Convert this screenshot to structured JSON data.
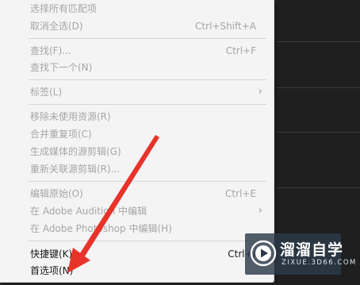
{
  "menu": {
    "items": [
      {
        "label": "选择所有匹配项",
        "shortcut": "",
        "enabled": false
      },
      {
        "label": "取消全选(D)",
        "shortcut": "Ctrl+Shift+A",
        "enabled": false
      },
      {
        "label": "查找(F)...",
        "shortcut": "Ctrl+F",
        "enabled": false
      },
      {
        "label": "查找下一个(N)",
        "shortcut": "",
        "enabled": false
      },
      {
        "label": "标签(L)",
        "shortcut": "",
        "enabled": false,
        "submenu": true
      },
      {
        "label": "移除未使用资源(R)",
        "shortcut": "",
        "enabled": false
      },
      {
        "label": "合并重复项(C)",
        "shortcut": "",
        "enabled": false
      },
      {
        "label": "生成媒体的源剪辑(G)",
        "shortcut": "",
        "enabled": false
      },
      {
        "label": "重新关联源剪辑(R)...",
        "shortcut": "",
        "enabled": false
      },
      {
        "label": "编辑原始(O)",
        "shortcut": "Ctrl+E",
        "enabled": false
      },
      {
        "label": "在 Adobe Audition 中编辑",
        "shortcut": "",
        "enabled": false,
        "submenu": true
      },
      {
        "label": "在 Adobe Photoshop 中编辑(H)",
        "shortcut": "",
        "enabled": false
      },
      {
        "label": "快捷键(K)...",
        "shortcut": "Ctrl+Alt+",
        "enabled": true
      },
      {
        "label": "首选项(N)",
        "shortcut": "",
        "enabled": true
      }
    ],
    "submenu_arrow": "›"
  },
  "watermark": {
    "title": "溜溜自学",
    "subtitle": "ZIXUE.3D66.COM",
    "icon": "play-logo-icon"
  },
  "annotation": {
    "icon": "red-arrow-icon",
    "color": "#e8332a"
  },
  "colors": {
    "menu_bg": "#f4f4f4",
    "disabled_text": "#a6a6a6",
    "enabled_text": "#1a1a1a",
    "dark_bg": "#1f1f1f"
  }
}
